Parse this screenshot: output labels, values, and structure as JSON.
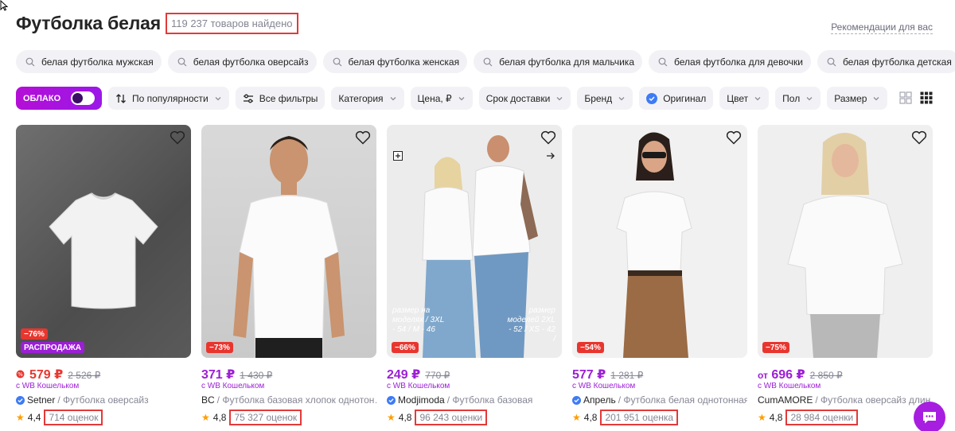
{
  "header": {
    "title": "Футболка белая",
    "found_count": "119 237 товаров найдено",
    "recommendations_link": "Рекомендации для вас"
  },
  "chips": [
    {
      "label": "белая футболка мужская",
      "icon": "search-icon"
    },
    {
      "label": "белая футболка оверсайз",
      "icon": "search-icon"
    },
    {
      "label": "белая футболка женская",
      "icon": "search-icon"
    },
    {
      "label": "белая футболка для мальчика",
      "icon": "search-icon"
    },
    {
      "label": "белая футболка для девочки",
      "icon": "search-icon"
    },
    {
      "label": "белая футболка детская",
      "icon": "search-icon"
    }
  ],
  "filters": {
    "oblako_label": "ОБЛАКО",
    "sort_label": "По популярности",
    "all_filters_label": "Все фильтры",
    "category_label": "Категория",
    "price_label": "Цена, ₽",
    "delivery_label": "Срок доставки",
    "brand_label": "Бренд",
    "original_label": "Оригинал",
    "color_label": "Цвет",
    "gender_label": "Пол",
    "size_label": "Размер"
  },
  "colors": {
    "accent": "#9c1fd6",
    "discount": "#e8362f",
    "highlight_box": "#e23a3a"
  },
  "products": [
    {
      "discount": "−76%",
      "sale_badge": "РАСПРОДАЖА",
      "price": "579 ₽",
      "old_price": "2 526 ₽",
      "wallet": "с WB Кошельком",
      "brand": "Setner",
      "name": "/ Футболка оверсайз",
      "rating": "4,4",
      "reviews": "714 оценок"
    },
    {
      "discount": "−73%",
      "price": "371 ₽",
      "old_price": "1 430 ₽",
      "wallet": "с WB Кошельком",
      "brand": "BC",
      "name": "/ Футболка базовая хлопок однотон…",
      "rating": "4,8",
      "reviews": "75 327 оценок"
    },
    {
      "discount": "−66%",
      "price": "249 ₽",
      "old_price": "770 ₽",
      "wallet": "с WB Кошельком",
      "brand": "Modjimoda",
      "name": "/ Футболка базовая",
      "rating": "4,8",
      "reviews": "96 243 оценки",
      "photo_text_left": "размер на моделях / 3XL - 54 / M - 46",
      "photo_text_right": "размер моделей 2XL - 52 / XS - 42 /"
    },
    {
      "discount": "−54%",
      "price": "577 ₽",
      "old_price": "1 281 ₽",
      "wallet": "с WB Кошельком",
      "brand": "Апрель",
      "name": "/ Футболка белая однотонная…",
      "rating": "4,8",
      "reviews": "201 951 оценка"
    },
    {
      "discount": "−75%",
      "price_prefix": "от",
      "price": "696 ₽",
      "old_price": "2 850 ₽",
      "wallet": "с WB Кошельком",
      "brand": "CumAMORE",
      "name": "/ Футболка оверсайз длин…",
      "rating": "4,8",
      "reviews": "28 984 оценки"
    }
  ]
}
